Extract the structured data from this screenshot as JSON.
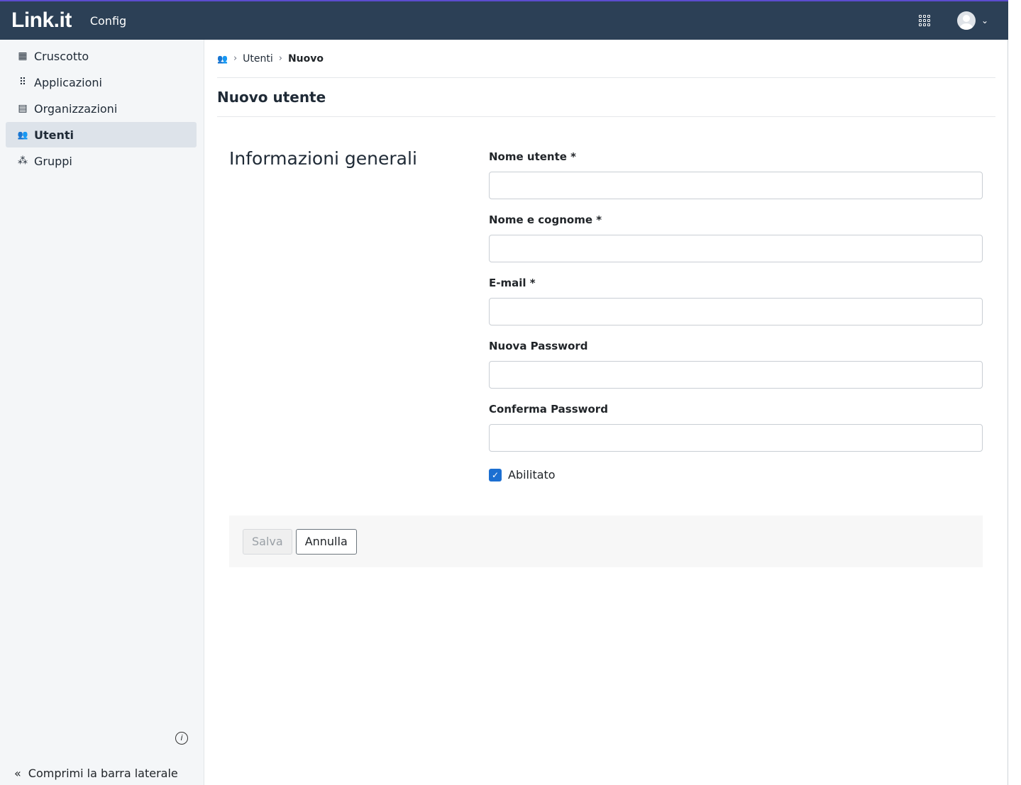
{
  "app": {
    "logo": "Link.it",
    "name": "Config"
  },
  "sidebar": {
    "items": [
      {
        "label": "Cruscotto",
        "icon": "dashboard-icon",
        "glyph": "▦"
      },
      {
        "label": "Applicazioni",
        "icon": "apps-grid-icon",
        "glyph": "⠿"
      },
      {
        "label": "Organizzazioni",
        "icon": "building-icon",
        "glyph": "▤"
      },
      {
        "label": "Utenti",
        "icon": "users-icon",
        "glyph": "👥",
        "active": true
      },
      {
        "label": "Gruppi",
        "icon": "groups-icon",
        "glyph": "⁂"
      }
    ],
    "collapse_label": "Comprimi la barra laterale",
    "collapse_glyph": "«",
    "info_glyph": "i"
  },
  "breadcrumb": {
    "home_icon": "users-icon",
    "sep": "›",
    "items": [
      "Utenti",
      "Nuovo"
    ]
  },
  "page": {
    "title": "Nuovo utente"
  },
  "form": {
    "section_title": "Informazioni generali",
    "fields": [
      {
        "label": "Nome utente *",
        "value": "",
        "placeholder": ""
      },
      {
        "label": "Nome e cognome *",
        "value": "",
        "placeholder": ""
      },
      {
        "label": "E-mail *",
        "value": "",
        "placeholder": ""
      },
      {
        "label": "Nuova Password",
        "value": "",
        "placeholder": ""
      },
      {
        "label": "Conferma Password",
        "value": "",
        "placeholder": ""
      }
    ],
    "enabled": {
      "label": "Abilitato",
      "checked": true,
      "check_glyph": "✓"
    },
    "save_label": "Salva",
    "cancel_label": "Annulla"
  },
  "colors": {
    "topbar": "#2c4056",
    "accent": "#1c6fd1",
    "sidebar": "#f4f6f8"
  }
}
